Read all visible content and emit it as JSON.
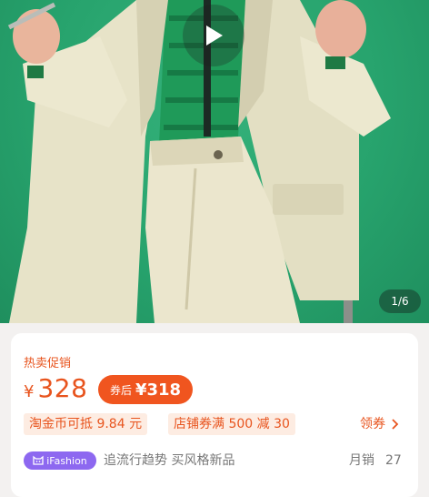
{
  "hero": {
    "image_counter": "1/6",
    "background_color": "#2aa86f"
  },
  "price_card": {
    "promo_label": "热卖促销",
    "currency": "¥",
    "price": "328",
    "coupon_label": "券后",
    "coupon_price": "¥318",
    "tags": [
      "淘金币可抵 9.84 元",
      "店铺券满 500 减 30"
    ],
    "claim_label": "领券",
    "brand_badge": "iFashion",
    "slogan": "追流行趋势 买风格新品",
    "sales_label": "月销",
    "sales_count": "27",
    "accent_color": "#e8541e"
  }
}
